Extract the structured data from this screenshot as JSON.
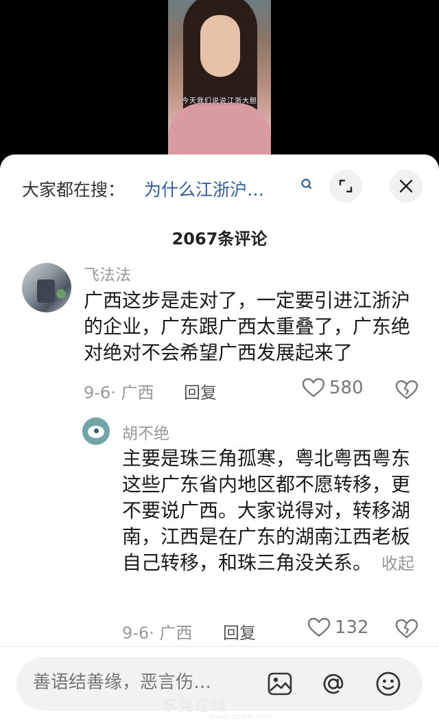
{
  "video": {
    "caption": "今天我们说说江浙大胆"
  },
  "search": {
    "prefix": "大家都在搜：",
    "query": "为什么江浙沪…",
    "query_icon": "search-q-icon"
  },
  "header": {
    "expand_icon": "expand-icon",
    "close_icon": "close-icon"
  },
  "comments": {
    "count_label": "2067条评论",
    "items": [
      {
        "username": "飞法法",
        "text": "广西这步是走对了，一定要引进江浙沪的企业，广东跟广西太重叠了，广东绝对绝对不会希望广西发展起来了",
        "date_location": "9-6· 广西",
        "reply_label": "回复",
        "likes": "580"
      },
      {
        "username": "胡不绝",
        "text": "主要是珠三角孤寒，粤北粤西粤东这些广东省内地区都不愿转移，更不要说广西。大家说得对，转移湖南，江西是在广东的湖南江西老板自己转移，和珠三角没关系。",
        "collapse_label": "收起",
        "date_location": "9-6· 广西",
        "reply_label": "回复",
        "likes": "132"
      }
    ]
  },
  "input_bar": {
    "placeholder": "善语结善缘，恶言伤…",
    "icons": [
      "image-icon",
      "at-icon",
      "emoji-icon"
    ]
  },
  "watermark": {
    "text": "东莞在线",
    "url": "WWW.GDMM.COM"
  }
}
